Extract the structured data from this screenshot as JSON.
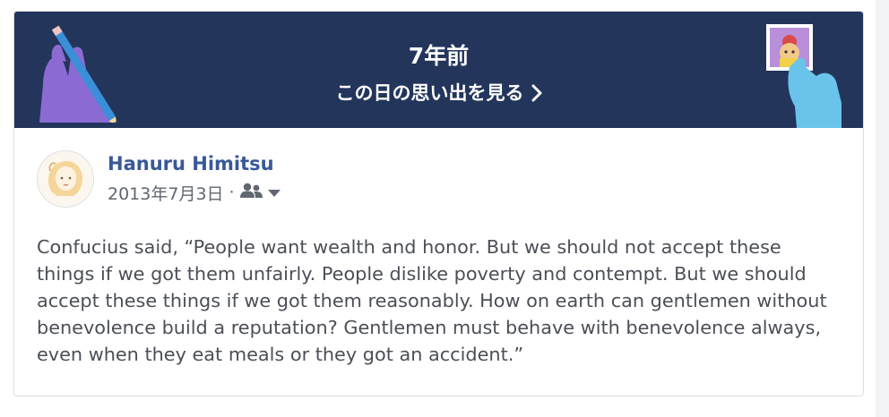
{
  "banner": {
    "years_ago": "7年前",
    "see_memories_label": "この日の思い出を見る"
  },
  "post": {
    "author": "Hanuru Himitsu",
    "date": "2013年7月3日",
    "separator": "·",
    "audience_icon": "friends-icon",
    "text": "Confucius said, “People want wealth and honor. But we should not accept these things if we got them unfairly. People dislike poverty and contempt. But we should accept these things if we got them reasonably. How on earth can gentlemen without benevolence build a reputation? Gentlemen must behave with benevolence always, even when they eat meals or they got an accident.”"
  },
  "colors": {
    "banner_bg": "#23355b",
    "author_link": "#385898",
    "meta_text": "#606770",
    "body_text": "#4b4f56",
    "card_border": "#dddfe2"
  }
}
